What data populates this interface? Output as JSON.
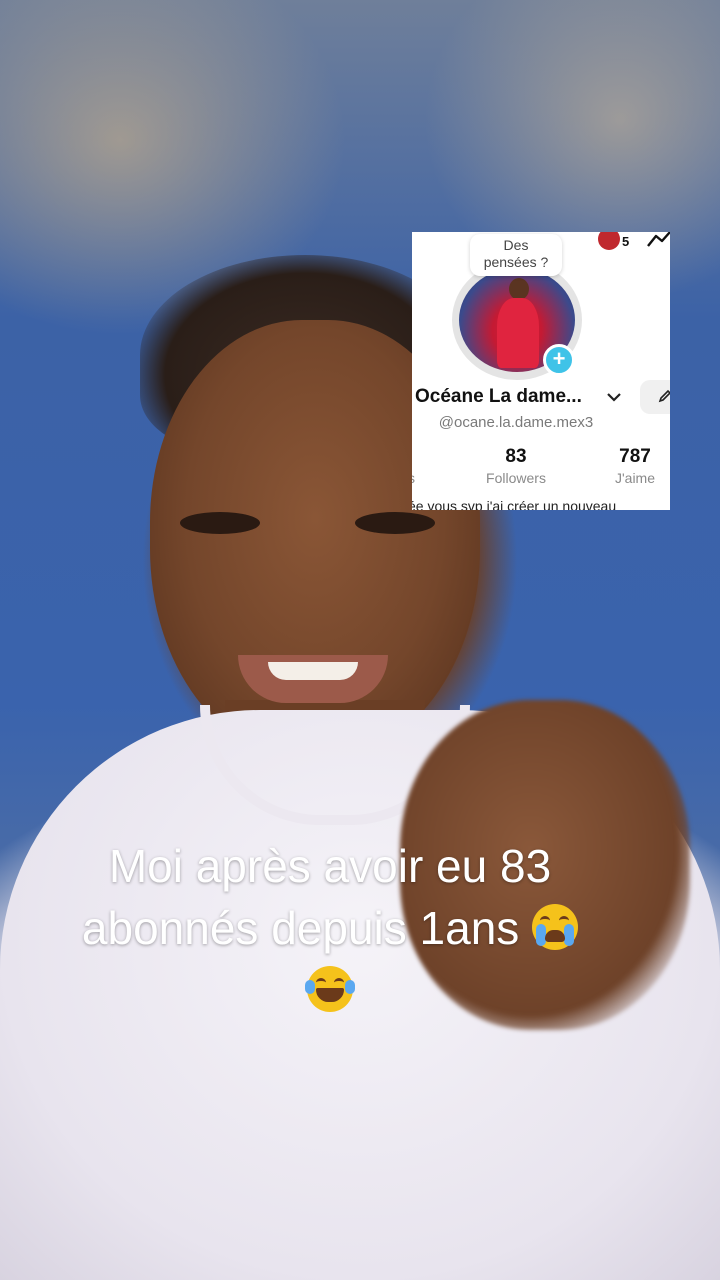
{
  "profile": {
    "thought_bubble": [
      "Des",
      "pensées ?"
    ],
    "name": "Océane La dame...",
    "handle": "@ocane.la.dame.mex3",
    "notification_count": "5",
    "stats": [
      {
        "value": "83",
        "label": "Followers"
      },
      {
        "value": "787",
        "label": "J'aime"
      }
    ],
    "cut_stat_label": "s",
    "bio_partial": "ée vous svp j'ai créer un nouveau"
  },
  "caption": {
    "line1": "Moi après avoir eu 83",
    "line2": "abonnés depuis 1ans",
    "emoji_crying": "loudly-crying-face-emoji",
    "emoji_laughing": "tears-of-joy-emoji"
  },
  "colors": {
    "accent_plus": "#3fc3e8",
    "caption_text": "#ffffff"
  }
}
